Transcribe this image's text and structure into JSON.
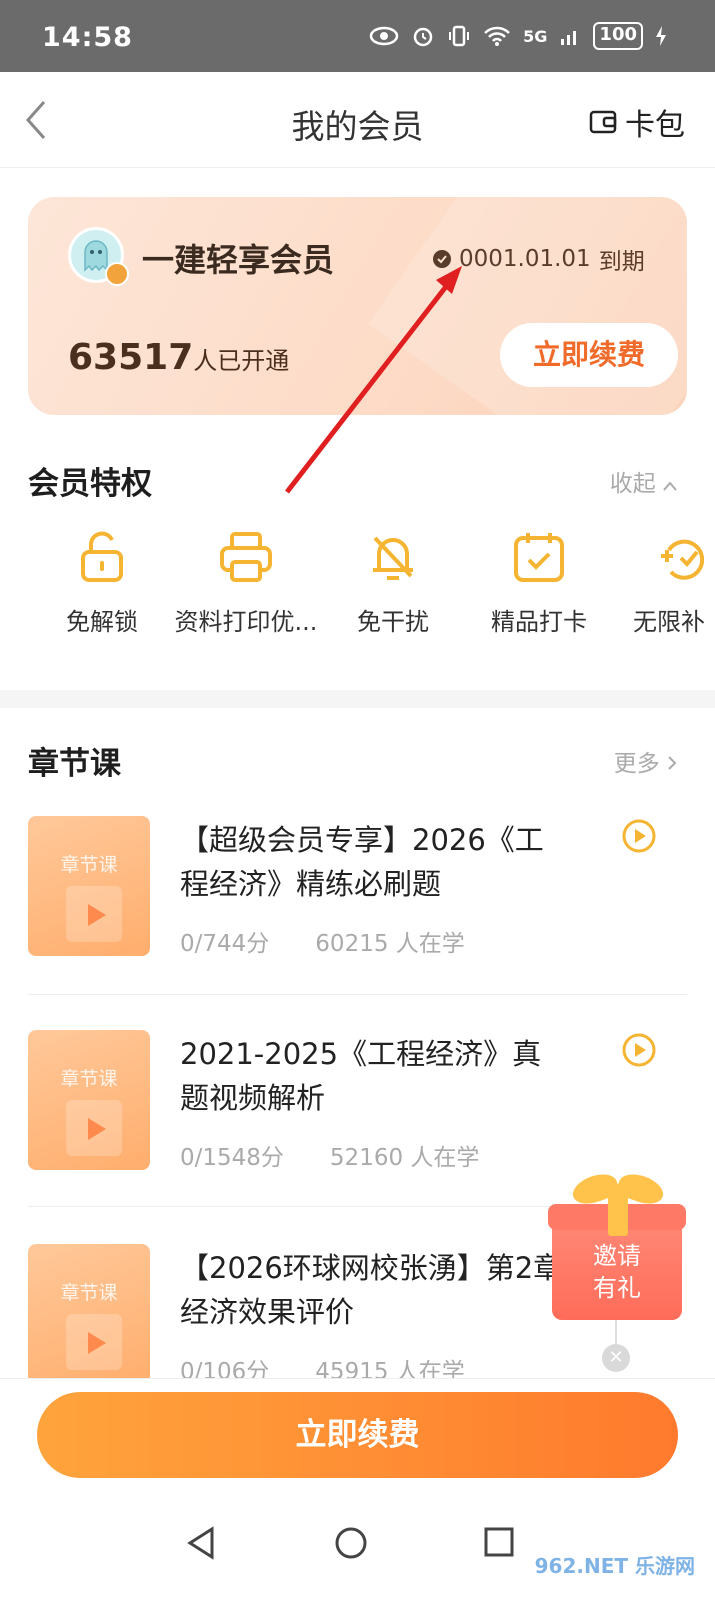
{
  "status_bar": {
    "time": "14:58",
    "network": "5G",
    "battery": "100"
  },
  "nav": {
    "title": "我的会员",
    "wallet_label": "卡包"
  },
  "member_card": {
    "title": "一建轻享会员",
    "expire_date": "0001.01.01",
    "expire_suffix": "到期",
    "members_count": "63517",
    "members_label": "人已开通",
    "renew_label": "立即续费"
  },
  "privileges": {
    "title": "会员特权",
    "collapse_label": "收起",
    "items": [
      {
        "label": "免解锁",
        "icon": "unlock-icon"
      },
      {
        "label": "资料打印优...",
        "icon": "printer-icon"
      },
      {
        "label": "免干扰",
        "icon": "bell-off-icon"
      },
      {
        "label": "精品打卡",
        "icon": "calendar-check-icon"
      },
      {
        "label": "无限补",
        "icon": "refresh-check-icon"
      }
    ]
  },
  "chapter": {
    "title": "章节课",
    "more_label": "更多",
    "thumb_label": "章节课",
    "courses": [
      {
        "title": "【超级会员专享】2026《工程经济》精练必刷题",
        "score": "0/744分",
        "learners": "60215 人在学"
      },
      {
        "title": "2021-2025《工程经济》真题视频解析",
        "score": "0/1548分",
        "learners": "52160 人在学"
      },
      {
        "title": "【2026环球网校张湧】第2章  经济效果评价",
        "score": "0/106分",
        "learners": "45915 人在学"
      }
    ]
  },
  "gift": {
    "line1": "邀请",
    "line2": "有礼"
  },
  "bottom": {
    "renew_label": "立即续费"
  },
  "watermark": "962.NET 乐游网",
  "colors": {
    "accent": "#ff7a2d",
    "gold": "#f5b431",
    "card": "#fddcc8"
  }
}
